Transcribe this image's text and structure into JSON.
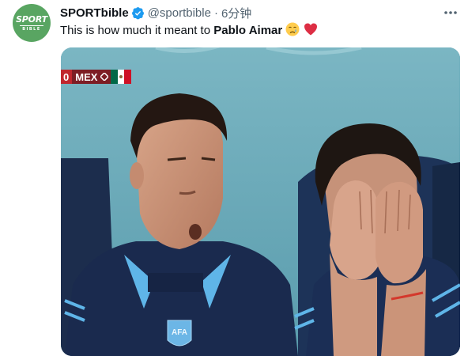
{
  "tweet": {
    "author_name": "SPORTbible",
    "handle": "@sportbible",
    "separator": "·",
    "time": "6分钟",
    "text_prefix": "This is how much it meant to ",
    "text_bold": "Pablo Aimar",
    "emojis": [
      "crying-face",
      "red-heart"
    ]
  },
  "avatar": {
    "line1": "SPORT",
    "line2": "BIBLE",
    "bg_color": "#59a562"
  },
  "media": {
    "scorebug": {
      "score": "0",
      "team": "MEX",
      "flag_colors": [
        "#006847",
        "#ffffff",
        "#ce1126"
      ]
    }
  },
  "colors": {
    "text": "#0f1419",
    "muted": "#536471",
    "verified": "#1d9bf0",
    "media_bg": "#63a3b3"
  }
}
